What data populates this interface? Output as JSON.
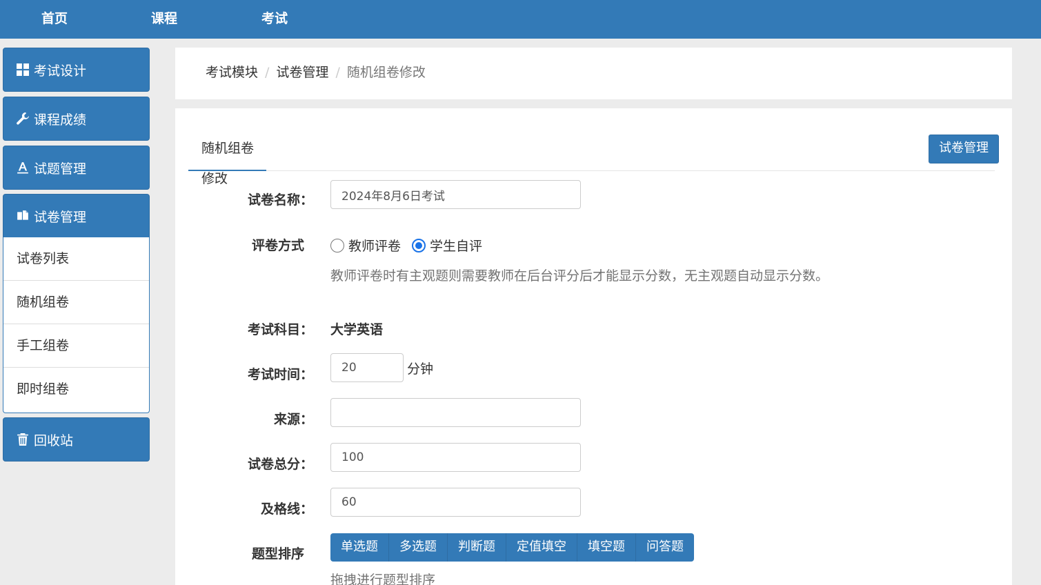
{
  "topnav": {
    "items": [
      "首页",
      "课程",
      "考试"
    ]
  },
  "sidebar": {
    "design": "考试设计",
    "scores": "课程成绩",
    "questions": "试题管理",
    "papers": "试卷管理",
    "sub_items": [
      "试卷列表",
      "随机组卷",
      "手工组卷",
      "即时组卷"
    ],
    "recycle": "回收站"
  },
  "breadcrumb": {
    "items": [
      "考试模块",
      "试卷管理",
      "随机组卷修改"
    ]
  },
  "panel": {
    "tab": "随机组卷修改",
    "manage_button": "试卷管理"
  },
  "form": {
    "name_label": "试卷名称：",
    "name_value": "2024年8月6日考试",
    "grading_label": "评卷方式",
    "grading_options": [
      "教师评卷",
      "学生自评"
    ],
    "grading_selected": "学生自评",
    "grading_help": "教师评卷时有主观题则需要教师在后台评分后才能显示分数，无主观题自动显示分数。",
    "subject_label": "考试科目：",
    "subject_value": "大学英语",
    "time_label": "考试时间：",
    "time_value": "20",
    "time_unit": "分钟",
    "source_label": "来源：",
    "source_value": "",
    "total_label": "试卷总分：",
    "total_value": "100",
    "pass_label": "及格线：",
    "pass_value": "60",
    "order_label": "题型排序",
    "order_types": [
      "单选题",
      "多选题",
      "判断题",
      "定值填空",
      "填空题",
      "问答题"
    ],
    "order_help": "拖拽进行题型排序"
  }
}
